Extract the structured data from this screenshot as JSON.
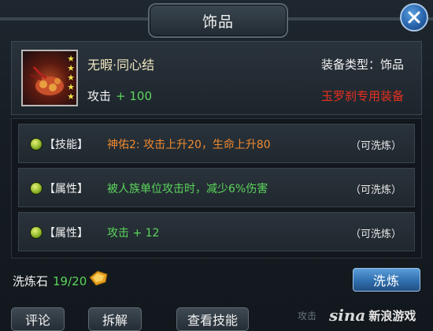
{
  "window": {
    "title": "饰品"
  },
  "item": {
    "name": "无暇·同心结",
    "type_text": "装备类型：饰品",
    "stat_label": "攻击",
    "stat_value": "+ 100",
    "exclusive": "玉罗刹专用装备",
    "stars": 5
  },
  "attributes": [
    {
      "bracket": "【技能】",
      "effect": "神佑2: 攻击上升20，生命上升80",
      "effect_color": "#f08a30",
      "status": "（可洗炼）"
    },
    {
      "bracket": "【属性】",
      "effect": "被人族单位攻击时，减少6%伤害",
      "effect_color": "#5bd65b",
      "status": "（可洗炼）"
    },
    {
      "bracket": "【属性】",
      "effect": "攻击 + 12",
      "effect_color": "#5bd65b",
      "status": "（可洗炼）"
    }
  ],
  "wash_stone": {
    "label": "洗炼石",
    "count": "19/20"
  },
  "buttons": {
    "wash": "洗炼",
    "comment": "评论",
    "disassemble": "拆解",
    "view_skills": "查看技能"
  },
  "background_text": "攻击",
  "watermark": {
    "logo": "sina",
    "text": "新浪游戏"
  },
  "colors": {
    "accent_blue": "#2f6fae",
    "positive_green": "#5bd65b",
    "skill_orange": "#f08a30",
    "exclusive_red": "#e83020"
  },
  "icons": {
    "close": "close-icon",
    "gem": "gem-icon",
    "stone": "wash-stone-icon"
  }
}
